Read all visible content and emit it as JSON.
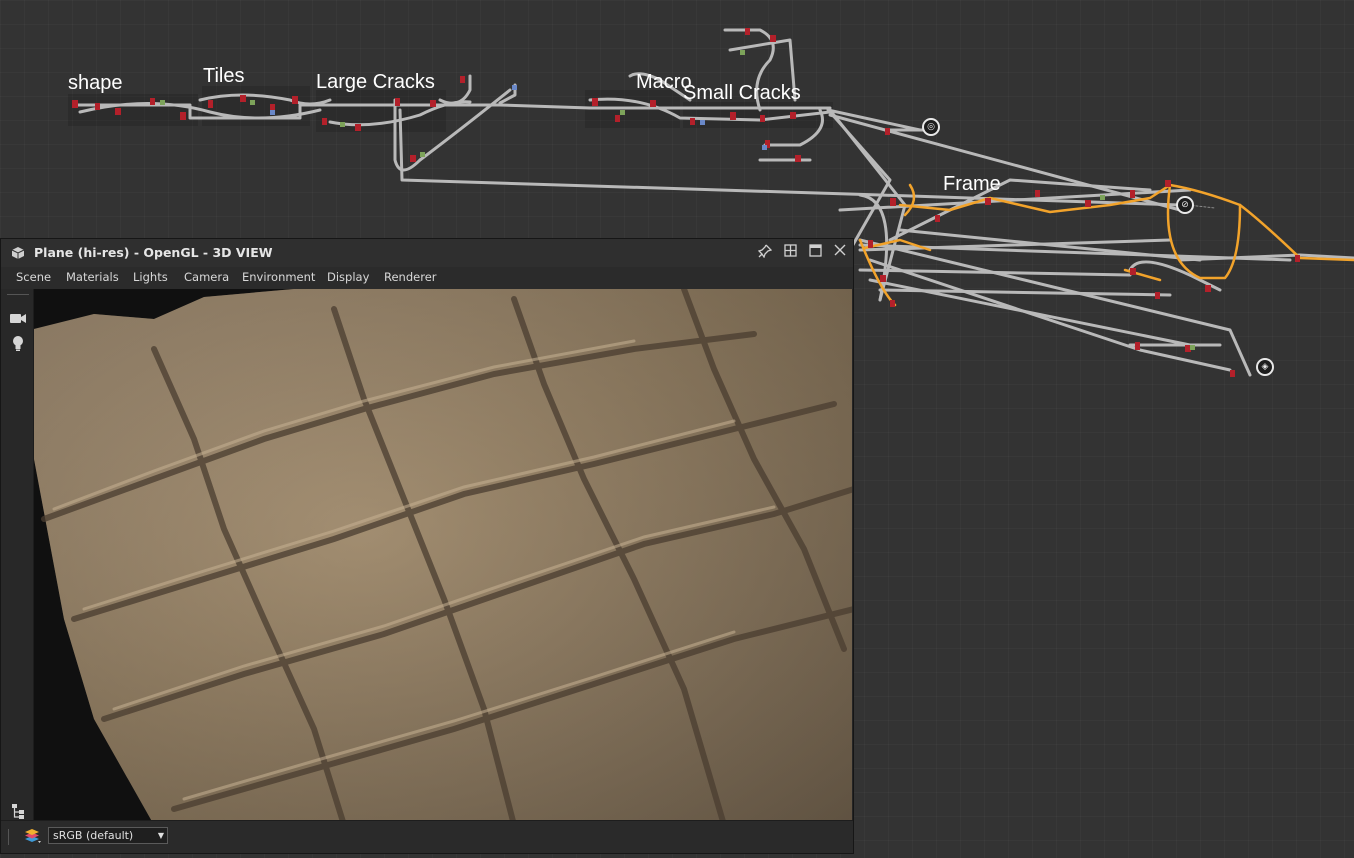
{
  "graph": {
    "frames": [
      {
        "label": "shape"
      },
      {
        "label": "Tiles"
      },
      {
        "label": "Large Cracks"
      },
      {
        "label": "Macro"
      },
      {
        "label": "Small Cracks"
      },
      {
        "label": "Frame"
      }
    ],
    "icons": [
      "target-node-icon",
      "disabled-node-icon",
      "output-node-icon"
    ]
  },
  "view3d": {
    "title": "Plane (hi-res) - OpenGL - 3D VIEW",
    "menu": [
      "Scene",
      "Materials",
      "Lights",
      "Camera",
      "Environment",
      "Display",
      "Renderer"
    ],
    "colorspace": "sRGB (default)",
    "tools": [
      "camera-icon",
      "light-bulb-icon",
      "hierarchy-icon"
    ]
  }
}
